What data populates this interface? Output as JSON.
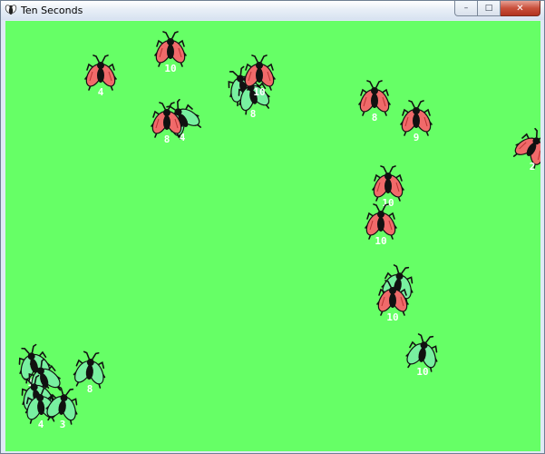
{
  "window": {
    "title": "Ten Seconds",
    "controls": {
      "minimize": "–",
      "maximize": "□",
      "close": "✕"
    }
  },
  "colors": {
    "field": "#66ff66",
    "red_fly_wing": "#f06a6a",
    "green_fly_wing": "#78f0a0",
    "fly_body": "#111111",
    "label": "#ffffff"
  },
  "icons": {
    "app": "fly-app-icon",
    "minimize": "minimize-icon",
    "maximize": "maximize-icon",
    "close": "close-icon"
  },
  "flies": [
    {
      "kind": "red",
      "label": "4"
    },
    {
      "kind": "red",
      "label": "10"
    },
    {
      "kind": "green",
      "label": "4"
    },
    {
      "kind": "green",
      "label": "8"
    },
    {
      "kind": "red",
      "label": "10"
    },
    {
      "kind": "green",
      "label": "4"
    },
    {
      "kind": "red",
      "label": "8"
    },
    {
      "kind": "red",
      "label": "8"
    },
    {
      "kind": "red",
      "label": "9"
    },
    {
      "kind": "red",
      "label": "2"
    },
    {
      "kind": "red",
      "label": "10"
    },
    {
      "kind": "red",
      "label": "10"
    },
    {
      "kind": "green",
      "label": "8"
    },
    {
      "kind": "red",
      "label": "10"
    },
    {
      "kind": "green",
      "label": "10"
    },
    {
      "kind": "green",
      "label": "10"
    },
    {
      "kind": "green",
      "label": "3"
    },
    {
      "kind": "green",
      "label": "8"
    },
    {
      "kind": "green",
      "label": "4"
    },
    {
      "kind": "green",
      "label": "3"
    },
    {
      "kind": "green",
      "label": "8"
    }
  ]
}
